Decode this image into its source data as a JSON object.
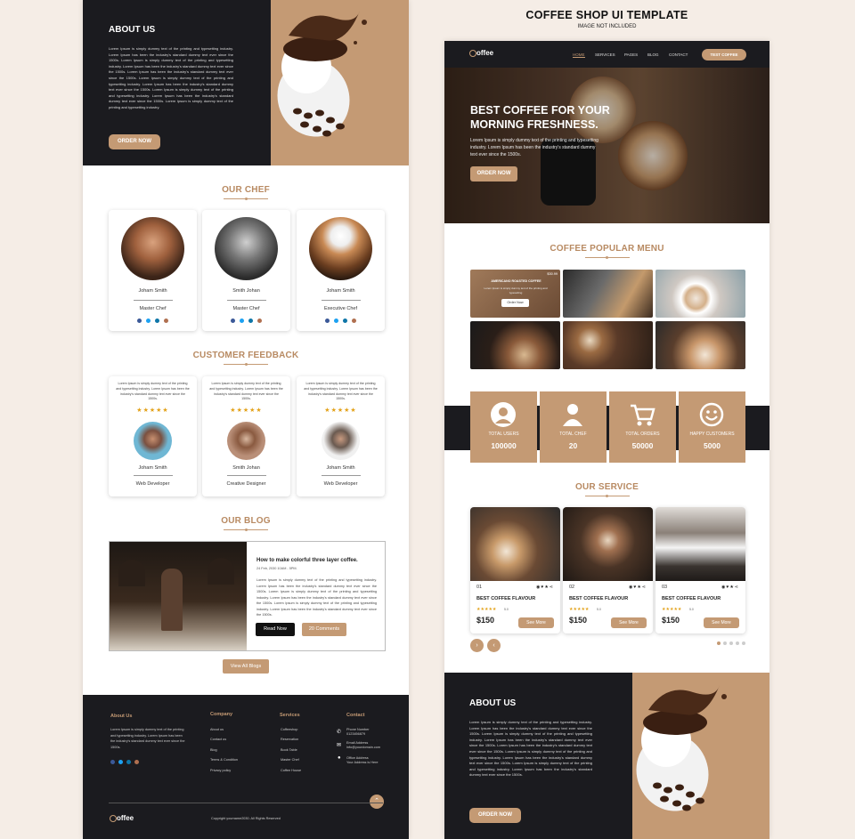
{
  "header": {
    "title": "COFFEE SHOP UI TEMPLATE",
    "subtitle": "IMAGE NOT INCLUDED"
  },
  "about": {
    "heading": "ABOUT US",
    "text": "Lorem Ipsum is simply dummy text of the printing and typesetting industry. Lorem Ipsum has been the industry's standard dummy text ever since the 1500s. Lorem Ipsum is simply dummy text of the printing and typesetting industry. Lorem Ipsum has been the industry's standard dummy text ever since the 1500s. Lorem Ipsum has been the industry's standard dummy text ever since the 1500s. Lorem Ipsum is simply dummy text of the printing and typesetting industry. Lorem Ipsum has been the industry's standard dummy text ever since the 1500s. Lorem Ipsum is simply dummy text of the printing and typesetting industry. Lorem Ipsum has been the industry's standard dummy text ever since the 1500s. Lorem Ipsum is simply dummy text of the printing and typesetting industry.",
    "button": "ORDER NOW"
  },
  "chef": {
    "heading": "OUR CHEF",
    "items": [
      {
        "name": "Joham Smith",
        "role": "Master Chef"
      },
      {
        "name": "Smith Johan",
        "role": "Master Chef"
      },
      {
        "name": "Joham Smith",
        "role": "Executive Chef"
      }
    ]
  },
  "feedback": {
    "heading": "CUSTOMER FEEDBACK",
    "text": "Lorem Ipsum is simply dummy text of the printing and typesetting industry. Lorem Ipsum has been the industry's standard dummy text ever since the 1500s.",
    "stars": "★★★★★",
    "items": [
      {
        "name": "Joham Smith",
        "role": "Web Developer"
      },
      {
        "name": "Smith Johan",
        "role": "Creative Designer"
      },
      {
        "name": "Joham Smith",
        "role": "Web Developer"
      }
    ]
  },
  "blog": {
    "heading": "OUR BLOG",
    "title": "How to make colorful three layer coffee.",
    "date": "24 Feb, 2030 10AM - 5PM.",
    "text": "Lorem Ipsum is simply dummy text of the printing and typesetting industry. Lorem Ipsum has been the industry's standard dummy text ever since the 1500s. Lorem Ipsum is simply dummy text of the printing and typesetting industry. Lorem Ipsum has been the industry's standard dummy text ever since the 1500s. Lorem Ipsum is simply dummy text of the printing and typesetting industry. Lorem Ipsum has been the industry's standard dummy text ever since the 1500s.",
    "read": "Read Now",
    "comments": "20 Comments",
    "view_all": "View All Blogs"
  },
  "footer": {
    "about_h": "About Us",
    "about_t": "Lorem Ipsum is simply dummy text of the printing and typesetting industry. Lorem Ipsum has been the industry's standard dummy text ever since the 1500s.",
    "company_h": "Company",
    "company": [
      "About us",
      "Contact us",
      "Blog",
      "Terms & Condition",
      "Privacy policy"
    ],
    "services_h": "Services",
    "services": [
      "Coffeeshop",
      "Reservation",
      "Book Table",
      "Master Chef",
      "Coffee House"
    ],
    "contact_h": "Contact",
    "phone_l": "Phone Number",
    "phone": "0123456879",
    "email_l": "Email Address",
    "email": "info@yourdomain.com",
    "addr_l": "Office Address",
    "addr": "Your Address is Here",
    "logo": "offee",
    "copyright": "Copyright yourname2030. All Rights Reserved"
  },
  "nav": {
    "logo": "offee",
    "items": [
      "HOME",
      "SERVICES",
      "PAGES",
      "BLOG",
      "CONTACT"
    ],
    "cta": "TEST COFFEE"
  },
  "hero": {
    "title_1": "BEST COFFEE FOR YOUR",
    "title_2": "MORNING FRESHNESS.",
    "text": "Lorem Ipsum is simply dummy text of the printing and typesetting industry. Lorem Ipsum has been the industry's standard dummy text ever since the 1500s.",
    "button": "ORDER NOW"
  },
  "menu": {
    "heading": "COFFEE POPULAR MENU",
    "first_title": "AMERICANO ROASTED COFFEE",
    "first_price": "$30.99",
    "first_text": "Lorem Ipsum is simply dummy text of the printing and typesetting",
    "first_btn": "Order Now"
  },
  "stats": [
    {
      "label": "TOTAL USERS",
      "value": "100000",
      "icon": "user-circle-icon"
    },
    {
      "label": "TOTAL CHEF",
      "value": "20",
      "icon": "person-icon"
    },
    {
      "label": "TOTAL ORDERS",
      "value": "50000",
      "icon": "cart-icon"
    },
    {
      "label": "HAPPY CUSTOMERS",
      "value": "5000",
      "icon": "smile-icon"
    }
  ],
  "service": {
    "heading": "OUR SERVICE",
    "items": [
      {
        "num": "01",
        "title": "BEST COFFEE FLAVOUR",
        "price": "$150",
        "rating": "5.0",
        "btn": "See More"
      },
      {
        "num": "02",
        "title": "BEST COFFEE FLAVOUR",
        "price": "$150",
        "rating": "5.0",
        "btn": "See More"
      },
      {
        "num": "03",
        "title": "BEST COFFEE FLAVOUR",
        "price": "$150",
        "rating": "5.0",
        "btn": "See More"
      }
    ]
  },
  "about2": {
    "heading": "ABOUT US",
    "text": "Lorem Ipsum is simply dummy text of the printing and typesetting industry. Lorem Ipsum has been the industry's standard dummy text ever since the 1500s. Lorem Ipsum is simply dummy text of the printing and typesetting industry. Lorem Ipsum has been the industry's standard dummy text ever since the 1500s. Lorem Ipsum has been the industry's standard dummy text ever since the 1500s. Lorem Ipsum is simply dummy text of the printing and typesetting industry. Lorem Ipsum has been the industry's standard dummy text ever since the 1500s. Lorem Ipsum is simply dummy text of the printing and typesetting industry. Lorem Ipsum has been the industry's standard dummy text ever since the 1500s.",
    "button": "ORDER NOW"
  },
  "colors": {
    "accent": "#c49a74",
    "dark": "#1b1b1f",
    "bg": "#f5ede6"
  }
}
